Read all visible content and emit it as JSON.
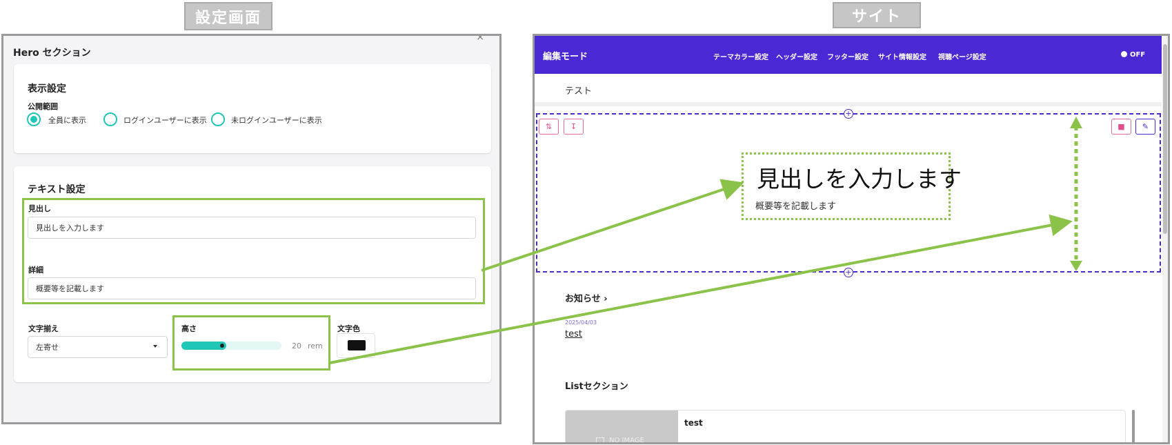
{
  "labels": {
    "settings": "設定画面",
    "site": "サイト"
  },
  "settings": {
    "title": "Hero セクション",
    "close": "×",
    "display": {
      "heading": "表示設定",
      "scope_label": "公開範囲",
      "options": [
        "全員に表示",
        "ログインユーザーに表示",
        "未ログインユーザーに表示"
      ],
      "selected": 0
    },
    "text": {
      "heading": "テキスト設定",
      "headline_label": "見出し",
      "headline_value": "見出しを入力します",
      "detail_label": "詳細",
      "detail_value": "概要等を記載します",
      "align_label": "文字揃え",
      "align_value": "左寄せ",
      "height_label": "高さ",
      "height_value": "20",
      "height_unit": "rem",
      "height_fraction": 0.45,
      "color_label": "文字色",
      "color_value": "#111111"
    }
  },
  "site": {
    "brand": "編集モード",
    "nav": [
      "テーマカラー設定",
      "ヘッダー設定",
      "フッター設定",
      "サイト情報設定",
      "視聴ページ設定"
    ],
    "toggle": "OFF",
    "page_title": "テスト",
    "hero": {
      "title": "見出しを入力します",
      "subtitle": "概要等を記載します"
    },
    "news": {
      "heading": "お知らせ",
      "chevron": "›",
      "date": "2025/04/03",
      "item": "test"
    },
    "list": {
      "heading": "Listセクション",
      "card_title": "test",
      "no_image": "NO IMAGE"
    }
  },
  "colors": {
    "accent": "#4a28d4",
    "highlight": "#8bc34a",
    "teal": "#20c6b6",
    "pink": "#e14d8c"
  }
}
